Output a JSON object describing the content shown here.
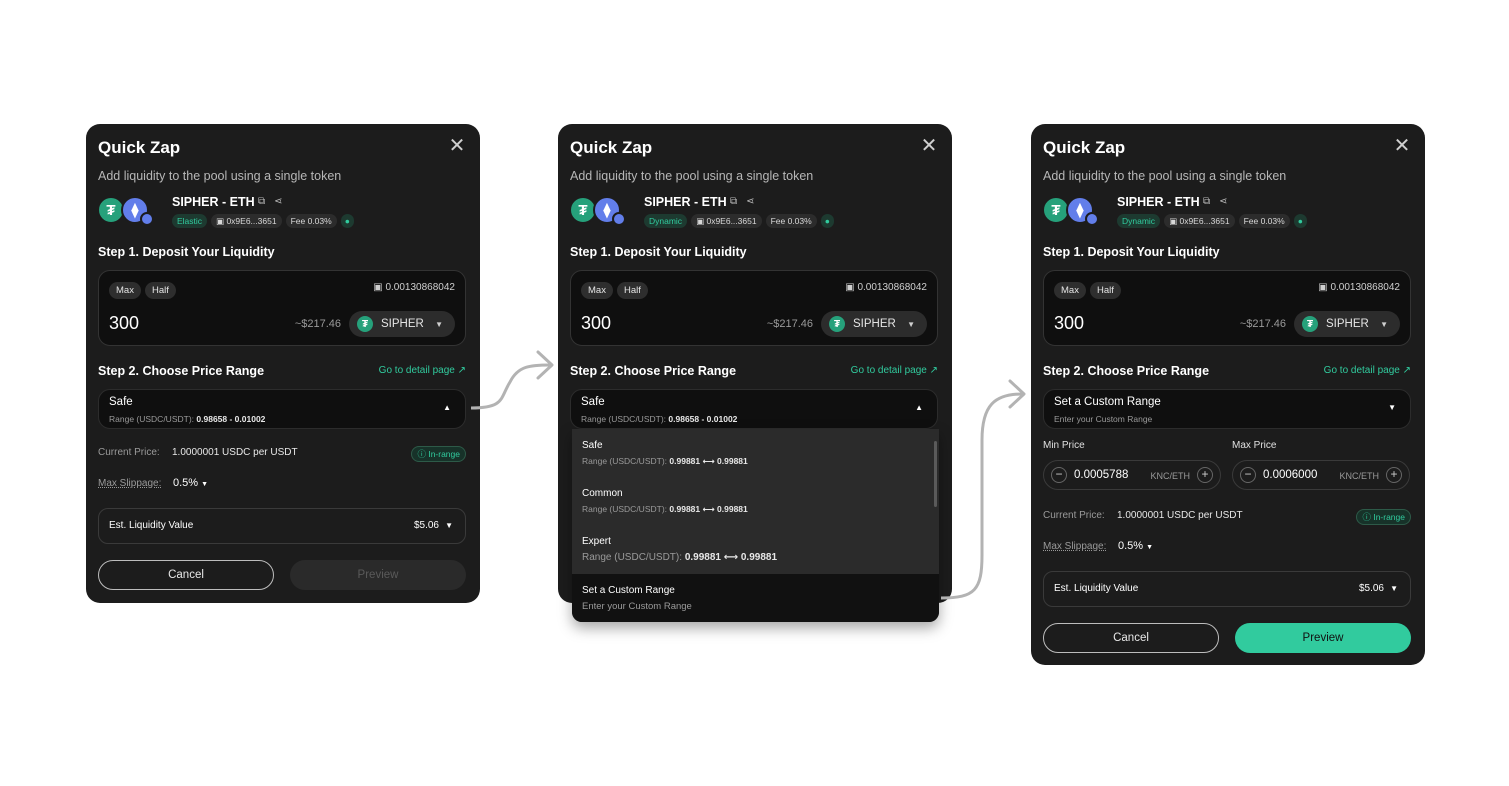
{
  "common": {
    "title": "Quick Zap",
    "subtitle": "Add liquidity to the pool using a single token",
    "pair": "SIPHER - ETH",
    "address": "0x9E6...3651",
    "fee": "Fee 0.03%",
    "step1": "Step 1. Deposit Your Liquidity",
    "max": "Max",
    "half": "Half",
    "balance": "0.00130868042",
    "amount": "300",
    "usd_value": "~$217.46",
    "token": "SIPHER",
    "step2": "Step 2. Choose Price Range",
    "detail_link": "Go to detail page ↗",
    "current_price_label": "Current Price:",
    "current_price_value": "1.0000001 USDC per USDT",
    "in_range": "In-range",
    "slippage_label": "Max Slippage:",
    "slippage_value": "0.5%",
    "est_label": "Est. Liquidity Value",
    "est_value": "$5.06",
    "cancel": "Cancel",
    "preview": "Preview"
  },
  "panel1": {
    "pool_type": "Elastic",
    "range_label": "Safe",
    "range_prefix": "Range (USDC/USDT):",
    "range_value": "0.98658 - 0.01002"
  },
  "panel2": {
    "pool_type": "Dynamic",
    "range_label": "Safe",
    "range_prefix": "Range (USDC/USDT):",
    "range_value": "0.98658 - 0.01002",
    "options": [
      {
        "label": "Safe",
        "prefix": "Range (USDC/USDT):",
        "value": "0.99881 ⟷ 0.99881"
      },
      {
        "label": "Common",
        "prefix": "Range (USDC/USDT):",
        "value": "0.99881 ⟷ 0.99881"
      },
      {
        "label": "Expert",
        "prefix": "Range (USDC/USDT):",
        "value": "0.99881 ⟷ 0.99881"
      }
    ],
    "custom_label": "Set a Custom Range",
    "custom_sub": "Enter your Custom Range"
  },
  "panel3": {
    "pool_type": "Dynamic",
    "range_label": "Set a Custom Range",
    "range_sub": "Enter your Custom Range",
    "min_label": "Min Price",
    "max_label": "Max Price",
    "min_value": "0.0005788",
    "max_value": "0.0006000",
    "unit": "KNC/ETH"
  },
  "colors": {
    "panel_bg": "#1c1c1c",
    "accent": "#31cb9e",
    "usdt": "#26a17b",
    "eth": "#627eea"
  }
}
